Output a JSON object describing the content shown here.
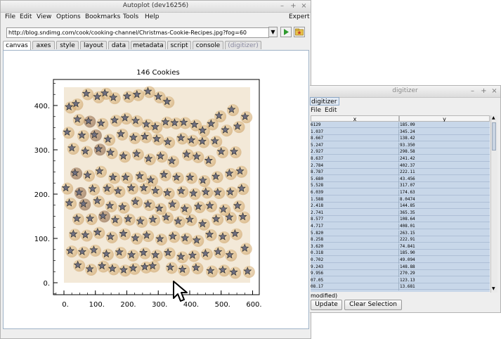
{
  "autoplot": {
    "title": "Autoplot (dev16256)",
    "menus": [
      "File",
      "Edit",
      "View",
      "Options",
      "Bookmarks",
      "Tools",
      "Help"
    ],
    "expert_label": "Expert",
    "url": "http://blog.sndimg.com/cook/cooking-channel/Christmas-Cookie-Recipes.jpg?fog=60",
    "tabs": [
      "canvas",
      "axes",
      "style",
      "layout",
      "data",
      "metadata",
      "script",
      "console",
      "(digitizer)"
    ],
    "active_tab": "canvas",
    "icons": {
      "dropdown": "chevron-down-icon",
      "go": "play-icon",
      "bookmark": "folder-star-icon",
      "minimize": "minimize-icon",
      "maximize": "maximize-icon",
      "close": "close-icon"
    }
  },
  "chart_data": {
    "type": "scatter",
    "title": "146 Cookies",
    "xlabel": "",
    "ylabel": "",
    "xlim": [
      -35,
      625
    ],
    "ylim": [
      -12,
      459
    ],
    "xticks": [
      "0.",
      "100.",
      "200.",
      "300.",
      "400.",
      "500.",
      "600."
    ],
    "yticks": [
      "0.",
      "100.",
      "200.",
      "300.",
      "400."
    ],
    "marker": "star",
    "marker_color": "#6e6e7e",
    "background": "cookie photo",
    "points": [
      {
        "x": 16,
        "y": 397
      },
      {
        "x": 38,
        "y": 404
      },
      {
        "x": 71,
        "y": 427
      },
      {
        "x": 106,
        "y": 420
      },
      {
        "x": 130,
        "y": 428
      },
      {
        "x": 157,
        "y": 418
      },
      {
        "x": 201,
        "y": 421
      },
      {
        "x": 232,
        "y": 425
      },
      {
        "x": 267,
        "y": 432
      },
      {
        "x": 300,
        "y": 420
      },
      {
        "x": 328,
        "y": 409
      },
      {
        "x": 43,
        "y": 369
      },
      {
        "x": 78,
        "y": 365
      },
      {
        "x": 118,
        "y": 360
      },
      {
        "x": 161,
        "y": 367
      },
      {
        "x": 194,
        "y": 372
      },
      {
        "x": 228,
        "y": 366
      },
      {
        "x": 262,
        "y": 358
      },
      {
        "x": 290,
        "y": 352
      },
      {
        "x": 323,
        "y": 363
      },
      {
        "x": 352,
        "y": 361
      },
      {
        "x": 381,
        "y": 362
      },
      {
        "x": 415,
        "y": 357
      },
      {
        "x": 441,
        "y": 344
      },
      {
        "x": 468,
        "y": 359
      },
      {
        "x": 493,
        "y": 377
      },
      {
        "x": 533,
        "y": 391
      },
      {
        "x": 576,
        "y": 375
      },
      {
        "x": 10,
        "y": 340
      },
      {
        "x": 57,
        "y": 333
      },
      {
        "x": 97,
        "y": 334
      },
      {
        "x": 140,
        "y": 324
      },
      {
        "x": 181,
        "y": 336
      },
      {
        "x": 221,
        "y": 328
      },
      {
        "x": 257,
        "y": 330
      },
      {
        "x": 295,
        "y": 325
      },
      {
        "x": 330,
        "y": 318
      },
      {
        "x": 372,
        "y": 327
      },
      {
        "x": 405,
        "y": 322
      },
      {
        "x": 440,
        "y": 319
      },
      {
        "x": 480,
        "y": 320
      },
      {
        "x": 513,
        "y": 345
      },
      {
        "x": 552,
        "y": 353
      },
      {
        "x": 25,
        "y": 304
      },
      {
        "x": 68,
        "y": 297
      },
      {
        "x": 110,
        "y": 302
      },
      {
        "x": 148,
        "y": 294
      },
      {
        "x": 189,
        "y": 286
      },
      {
        "x": 231,
        "y": 291
      },
      {
        "x": 269,
        "y": 280
      },
      {
        "x": 307,
        "y": 286
      },
      {
        "x": 343,
        "y": 275
      },
      {
        "x": 390,
        "y": 290
      },
      {
        "x": 422,
        "y": 285
      },
      {
        "x": 460,
        "y": 276
      },
      {
        "x": 500,
        "y": 296
      },
      {
        "x": 541,
        "y": 296
      },
      {
        "x": 35,
        "y": 248
      },
      {
        "x": 75,
        "y": 243
      },
      {
        "x": 113,
        "y": 252
      },
      {
        "x": 156,
        "y": 238
      },
      {
        "x": 196,
        "y": 238
      },
      {
        "x": 241,
        "y": 241
      },
      {
        "x": 276,
        "y": 232
      },
      {
        "x": 318,
        "y": 244
      },
      {
        "x": 358,
        "y": 238
      },
      {
        "x": 401,
        "y": 238
      },
      {
        "x": 442,
        "y": 231
      },
      {
        "x": 483,
        "y": 240
      },
      {
        "x": 526,
        "y": 247
      },
      {
        "x": 560,
        "y": 252
      },
      {
        "x": 6,
        "y": 214
      },
      {
        "x": 48,
        "y": 204
      },
      {
        "x": 91,
        "y": 212
      },
      {
        "x": 137,
        "y": 213
      },
      {
        "x": 172,
        "y": 207
      },
      {
        "x": 214,
        "y": 214
      },
      {
        "x": 254,
        "y": 214
      },
      {
        "x": 291,
        "y": 208
      },
      {
        "x": 329,
        "y": 203
      },
      {
        "x": 373,
        "y": 207
      },
      {
        "x": 412,
        "y": 202
      },
      {
        "x": 451,
        "y": 205
      },
      {
        "x": 489,
        "y": 204
      },
      {
        "x": 529,
        "y": 205
      },
      {
        "x": 565,
        "y": 213
      },
      {
        "x": 17,
        "y": 180
      },
      {
        "x": 62,
        "y": 178
      },
      {
        "x": 106,
        "y": 185
      },
      {
        "x": 146,
        "y": 174
      },
      {
        "x": 186,
        "y": 171
      },
      {
        "x": 227,
        "y": 183
      },
      {
        "x": 267,
        "y": 177
      },
      {
        "x": 303,
        "y": 168
      },
      {
        "x": 345,
        "y": 177
      },
      {
        "x": 384,
        "y": 167
      },
      {
        "x": 427,
        "y": 172
      },
      {
        "x": 464,
        "y": 174
      },
      {
        "x": 507,
        "y": 166
      },
      {
        "x": 552,
        "y": 174
      },
      {
        "x": 41,
        "y": 145
      },
      {
        "x": 83,
        "y": 145
      },
      {
        "x": 124,
        "y": 151
      },
      {
        "x": 163,
        "y": 142
      },
      {
        "x": 204,
        "y": 144
      },
      {
        "x": 243,
        "y": 139
      },
      {
        "x": 283,
        "y": 143
      },
      {
        "x": 325,
        "y": 148
      },
      {
        "x": 363,
        "y": 139
      },
      {
        "x": 400,
        "y": 143
      },
      {
        "x": 441,
        "y": 133
      },
      {
        "x": 484,
        "y": 144
      },
      {
        "x": 526,
        "y": 148
      },
      {
        "x": 569,
        "y": 149
      },
      {
        "x": 30,
        "y": 110
      },
      {
        "x": 68,
        "y": 108
      },
      {
        "x": 107,
        "y": 114
      },
      {
        "x": 148,
        "y": 104
      },
      {
        "x": 189,
        "y": 111
      },
      {
        "x": 227,
        "y": 101
      },
      {
        "x": 263,
        "y": 107
      },
      {
        "x": 305,
        "y": 99
      },
      {
        "x": 346,
        "y": 105
      },
      {
        "x": 385,
        "y": 101
      },
      {
        "x": 422,
        "y": 96
      },
      {
        "x": 463,
        "y": 109
      },
      {
        "x": 505,
        "y": 104
      },
      {
        "x": 544,
        "y": 111
      },
      {
        "x": 20,
        "y": 72
      },
      {
        "x": 58,
        "y": 70
      },
      {
        "x": 95,
        "y": 74
      },
      {
        "x": 135,
        "y": 65
      },
      {
        "x": 176,
        "y": 69
      },
      {
        "x": 215,
        "y": 63
      },
      {
        "x": 253,
        "y": 68
      },
      {
        "x": 291,
        "y": 63
      },
      {
        "x": 331,
        "y": 68
      },
      {
        "x": 372,
        "y": 59
      },
      {
        "x": 409,
        "y": 62
      },
      {
        "x": 450,
        "y": 66
      },
      {
        "x": 490,
        "y": 70
      },
      {
        "x": 527,
        "y": 63
      },
      {
        "x": 575,
        "y": 78
      },
      {
        "x": 44,
        "y": 40
      },
      {
        "x": 82,
        "y": 31
      },
      {
        "x": 121,
        "y": 38
      },
      {
        "x": 154,
        "y": 32
      },
      {
        "x": 190,
        "y": 29
      },
      {
        "x": 220,
        "y": 33
      },
      {
        "x": 257,
        "y": 36
      },
      {
        "x": 282,
        "y": 38
      },
      {
        "x": 338,
        "y": 35
      },
      {
        "x": 377,
        "y": 30
      },
      {
        "x": 420,
        "y": 34
      },
      {
        "x": 466,
        "y": 27
      },
      {
        "x": 505,
        "y": 29
      },
      {
        "x": 540,
        "y": 24
      },
      {
        "x": 584,
        "y": 26
      }
    ]
  },
  "digitizer": {
    "title": "digitizer",
    "menus": [
      "File",
      "Edit"
    ],
    "tab_label": "digitizer",
    "columns": [
      "x",
      "y"
    ],
    "rows": [
      [
        "6129",
        "185.09"
      ],
      [
        "1.037",
        "345.24"
      ],
      [
        "8.667",
        "138.42"
      ],
      [
        "5.247",
        "93.350"
      ],
      [
        "2.927",
        "298.58"
      ],
      [
        "8.637",
        "241.42"
      ],
      [
        "2.784",
        "402.37"
      ],
      [
        "8.787",
        "222.11"
      ],
      [
        "5.680",
        "43.456"
      ],
      [
        "5.528",
        "317.07"
      ],
      [
        "6.039",
        "174.63"
      ],
      [
        "1.588",
        "8.0474"
      ],
      [
        "2.418",
        "144.85"
      ],
      [
        "2.741",
        "365.35"
      ],
      [
        "8.577",
        "108.64"
      ],
      [
        "4.717",
        "408.01"
      ],
      [
        "5.820",
        "263.15"
      ],
      [
        "8.258",
        "222.91"
      ],
      [
        "3.620",
        "74.841"
      ],
      [
        "0.318",
        "185.90"
      ],
      [
        "0.702",
        "49.094"
      ],
      [
        "9.243",
        "148.88"
      ],
      [
        "9.956",
        "270.29"
      ],
      [
        "07.05",
        "123.13"
      ],
      [
        "08.17",
        "13.681"
      ]
    ],
    "status": "modified)",
    "update_label": "Update",
    "clear_label": "Clear Selection"
  }
}
